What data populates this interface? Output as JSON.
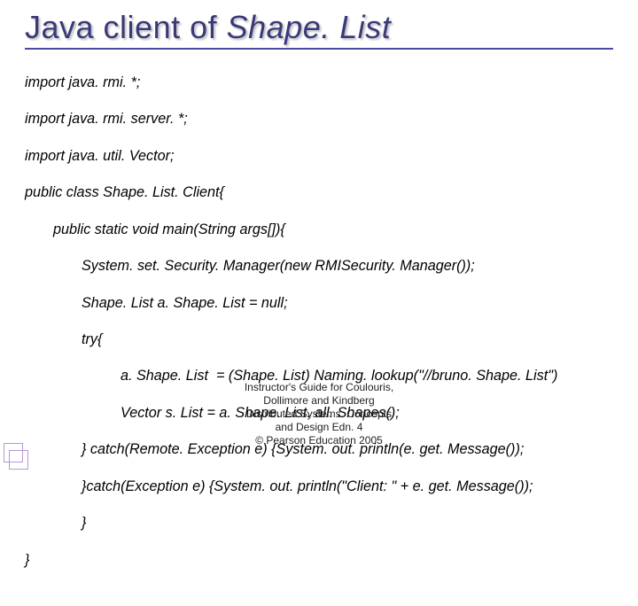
{
  "title": {
    "plain": "Java client of ",
    "italic": "Shape. List"
  },
  "code": {
    "l1": "import java. rmi. *;",
    "l2": "import java. rmi. server. *;",
    "l3": "import java. util. Vector;",
    "l4": "public class Shape. List. Client{",
    "l5": "public static void main(String args[]){",
    "l6": "System. set. Security. Manager(new RMISecurity. Manager());",
    "l7": "Shape. List a. Shape. List = null;",
    "l8": "try{",
    "l9": "a. Shape. List  = (Shape. List) Naming. lookup(\"//bruno. Shape. List\")",
    "l10": "Vector s. List = a. Shape. List. all. Shapes();",
    "l11": "} catch(Remote. Exception e) {System. out. println(e. get. Message());",
    "l12": "}catch(Exception e) {System. out. println(\"Client: \" + e. get. Message());",
    "l13": "}",
    "l14": "}"
  },
  "footer": {
    "l1": "Instructor's Guide for  Coulouris,",
    "l2": "Dollimore and Kindberg",
    "l3": "Distributed Systems: Concepts",
    "l4": "and Design   Edn. 4",
    "l5_pre": "©",
    "l5": "  Pearson Education 2005"
  }
}
